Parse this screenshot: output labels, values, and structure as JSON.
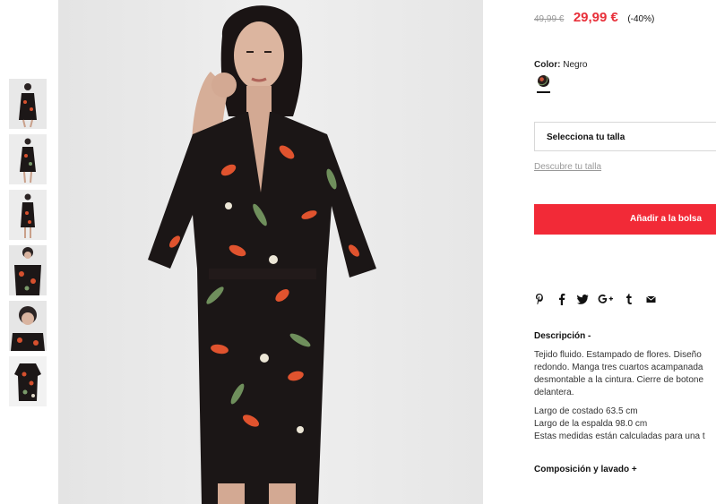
{
  "product": {
    "old_price": "49,99 €",
    "new_price": "29,99 €",
    "discount": "(-40%)",
    "color_label": "Color:",
    "color_value": "Negro",
    "size_select_label": "Selecciona tu talla",
    "size_guide_link": "Descubre tu talla",
    "add_to_bag_label": "Añadir a la bolsa",
    "accent_color": "#f22a37",
    "price_color": "#e8303a"
  },
  "share_icons": [
    "pinterest-icon",
    "facebook-icon",
    "twitter-icon",
    "google-plus-icon",
    "tumblr-icon",
    "email-icon"
  ],
  "description": {
    "title": "Descripción -",
    "text": "Tejido fluido. Estampado de flores. Diseño\nredondo. Manga tres cuartos acampanada\ndesmontable a la cintura. Cierre de botone\ndelantera.",
    "measures": [
      "Largo de costado 63.5 cm",
      "Largo de la espalda 98.0 cm",
      "Estas medidas están calculadas para una t"
    ]
  },
  "composition": {
    "title": "Composición y lavado +"
  },
  "thumbnails": [
    "thumbnail-1",
    "thumbnail-2",
    "thumbnail-3",
    "thumbnail-4",
    "thumbnail-5",
    "thumbnail-6"
  ]
}
